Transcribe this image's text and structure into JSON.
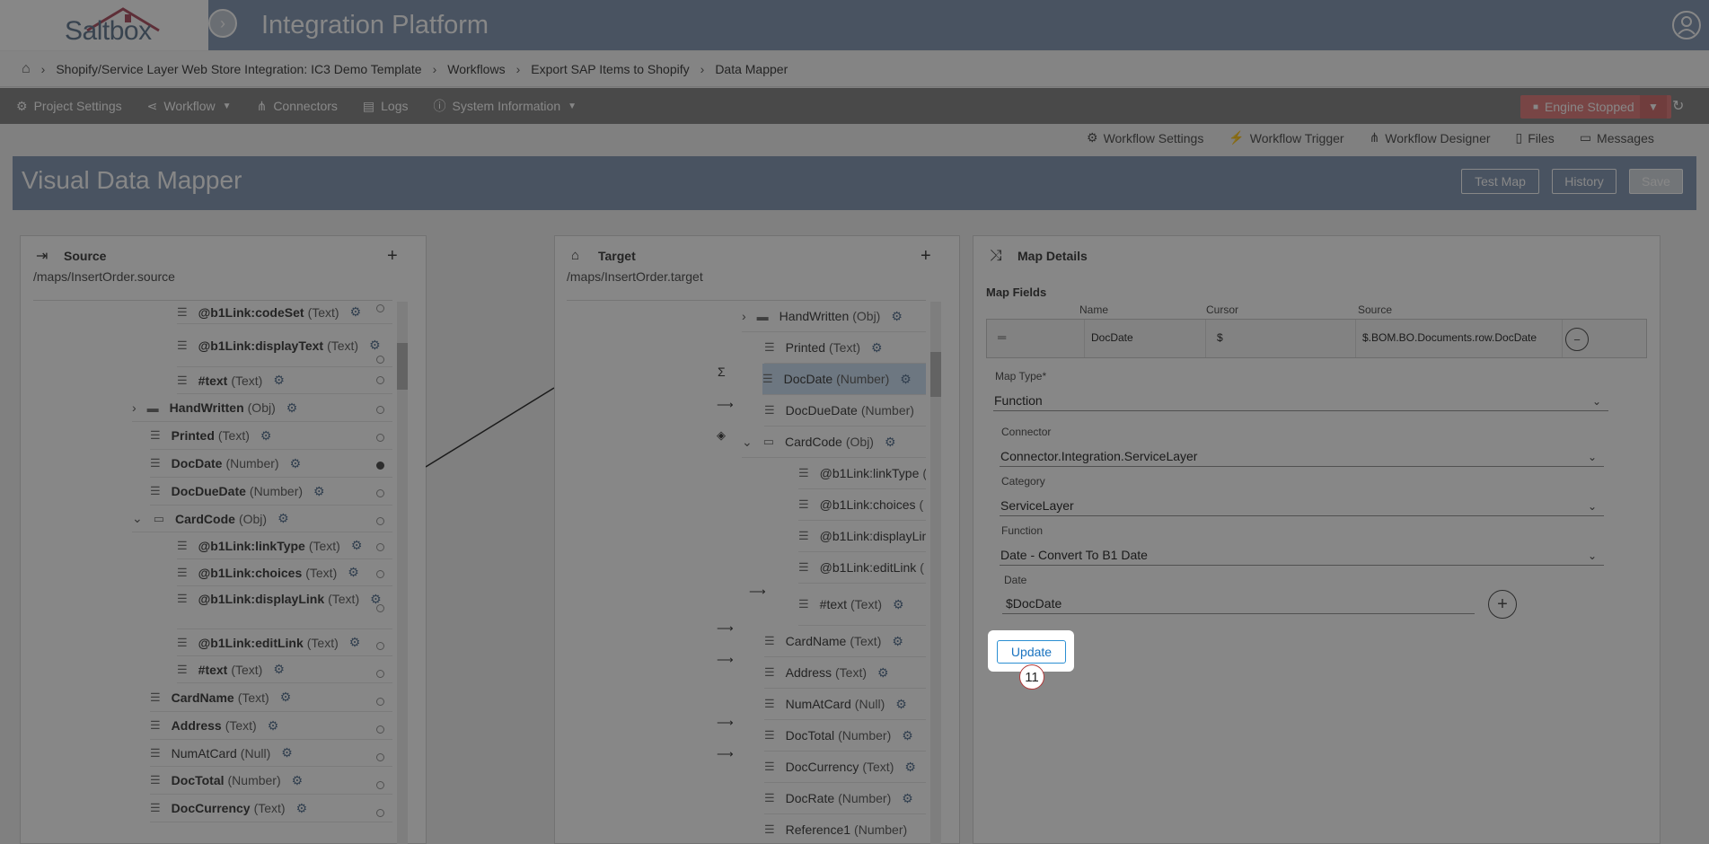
{
  "header": {
    "logo_text": "Saltbox",
    "app_title": "Integration Platform"
  },
  "breadcrumb": {
    "items": [
      "Shopify/Service Layer Web Store Integration: IC3 Demo Template",
      "Workflows",
      "Export SAP Items to Shopify",
      "Data Mapper"
    ]
  },
  "toolbar": {
    "project_settings": "Project Settings",
    "workflow": "Workflow",
    "connectors": "Connectors",
    "logs": "Logs",
    "system_information": "System Information",
    "engine_status": "Engine Stopped"
  },
  "sub_links": {
    "workflow_settings": "Workflow Settings",
    "workflow_trigger": "Workflow Trigger",
    "workflow_designer": "Workflow Designer",
    "files": "Files",
    "messages": "Messages"
  },
  "page": {
    "title": "Visual Data Mapper",
    "test_map": "Test Map",
    "history": "History",
    "save": "Save"
  },
  "source": {
    "title": "Source",
    "path": "/maps/InsertOrder.source",
    "rows": [
      {
        "name": "@b1Link:codeSet",
        "type": "(Text)"
      },
      {
        "name": "@b1Link:displayText",
        "type": "(Text)"
      },
      {
        "name": "#text",
        "type": "(Text)"
      },
      {
        "name": "HandWritten",
        "type": "(Obj)"
      },
      {
        "name": "Printed",
        "type": "(Text)"
      },
      {
        "name": "DocDate",
        "type": "(Number)"
      },
      {
        "name": "DocDueDate",
        "type": "(Number)"
      },
      {
        "name": "CardCode",
        "type": "(Obj)"
      },
      {
        "name": "@b1Link:linkType",
        "type": "(Text)"
      },
      {
        "name": "@b1Link:choices",
        "type": "(Text)"
      },
      {
        "name": "@b1Link:displayLink",
        "type": "(Text)"
      },
      {
        "name": "@b1Link:editLink",
        "type": "(Text)"
      },
      {
        "name": "#text",
        "type": "(Text)"
      },
      {
        "name": "CardName",
        "type": "(Text)"
      },
      {
        "name": "Address",
        "type": "(Text)"
      },
      {
        "name": "NumAtCard",
        "type": "(Null)"
      },
      {
        "name": "DocTotal",
        "type": "(Number)"
      },
      {
        "name": "DocCurrency",
        "type": "(Text)"
      }
    ]
  },
  "target": {
    "title": "Target",
    "path": "/maps/InsertOrder.target",
    "rows": [
      {
        "name": "HandWritten",
        "type": "(Obj)"
      },
      {
        "name": "Printed",
        "type": "(Text)"
      },
      {
        "name": "DocDate",
        "type": "(Number)"
      },
      {
        "name": "DocDueDate",
        "type": "(Number)"
      },
      {
        "name": "CardCode",
        "type": "(Obj)"
      },
      {
        "name": "@b1Link:linkType",
        "type": "("
      },
      {
        "name": "@b1Link:choices",
        "type": "("
      },
      {
        "name": "@b1Link:displayLin",
        "type": ""
      },
      {
        "name": "@b1Link:editLink",
        "type": "("
      },
      {
        "name": "#text",
        "type": "(Text)"
      },
      {
        "name": "CardName",
        "type": "(Text)"
      },
      {
        "name": "Address",
        "type": "(Text)"
      },
      {
        "name": "NumAtCard",
        "type": "(Null)"
      },
      {
        "name": "DocTotal",
        "type": "(Number)"
      },
      {
        "name": "DocCurrency",
        "type": "(Text)"
      },
      {
        "name": "DocRate",
        "type": "(Number)"
      },
      {
        "name": "Reference1",
        "type": "(Number)"
      }
    ]
  },
  "map_details": {
    "title": "Map Details",
    "map_fields_label": "Map Fields",
    "col_name": "Name",
    "col_cursor": "Cursor",
    "col_source": "Source",
    "row_name": "DocDate",
    "row_cursor": "$",
    "row_source": "$.BOM.BO.Documents.row.DocDate",
    "map_type_label": "Map Type*",
    "map_type_value": "Function",
    "connector_label": "Connector",
    "connector_value": "Connector.Integration.ServiceLayer",
    "category_label": "Category",
    "category_value": "ServiceLayer",
    "function_label": "Function",
    "function_value": "Date - Convert To B1 Date",
    "date_label": "Date",
    "date_value": "$DocDate",
    "update_label": "Update",
    "step_badge": "11"
  },
  "colors": {
    "header": "#8a9db8",
    "toolbar": "#8a8a8a",
    "engine": "#e38282",
    "accent": "#2b8fd2"
  }
}
